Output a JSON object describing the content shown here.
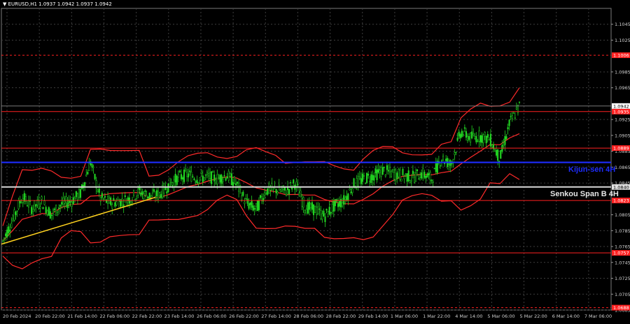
{
  "header": {
    "symbol_line": "▼ EURUSD,H1  1.0937 1.0942 1.0937 1.0942"
  },
  "chart_data": {
    "type": "candlestick",
    "symbol": "EURUSD",
    "timeframe": "H1",
    "ohlc": {
      "open": 1.0937,
      "high": 1.0942,
      "low": 1.0937,
      "close": 1.0942
    },
    "ylim": [
      1.0685,
      1.1065
    ],
    "y_ticks": [
      "1.1045",
      "1.1025",
      "1.0985",
      "1.0965",
      "1.0925",
      "1.0905",
      "1.0885",
      "1.0865",
      "1.0845",
      "1.0805",
      "1.0785",
      "1.0765",
      "1.0745",
      "1.0725",
      "1.0705",
      "1.0685"
    ],
    "x_ticks": [
      "20 Feb 2024",
      "20 Feb 22:00",
      "21 Feb 14:00",
      "22 Feb 06:00",
      "22 Feb 22:00",
      "23 Feb 14:00",
      "26 Feb 06:00",
      "26 Feb 22:00",
      "27 Feb 14:00",
      "28 Feb 06:00",
      "28 Feb 22:00",
      "29 Feb 14:00",
      "1 Mar 06:00",
      "1 Mar 22:00",
      "4 Mar 14:00",
      "5 Mar 06:00",
      "5 Mar 22:00",
      "6 Mar 14:00",
      "7 Mar 06:00"
    ],
    "current_price": "1.0942",
    "levels": [
      {
        "value": 1.1006,
        "label": "1.1006",
        "color": "#ff2020",
        "style": "dashed"
      },
      {
        "value": 1.0935,
        "label": "1.0935",
        "color": "#ff2020",
        "style": "solid"
      },
      {
        "value": 1.0889,
        "label": "1.0889",
        "color": "#ff2020",
        "style": "solid"
      },
      {
        "value": 1.0823,
        "label": "1.0823",
        "color": "#ff2020",
        "style": "solid"
      },
      {
        "value": 1.0757,
        "label": "1.0757",
        "color": "#ff2020",
        "style": "solid"
      },
      {
        "value": 1.0688,
        "label": "1.0688",
        "color": "#ff2020",
        "style": "dashed"
      }
    ],
    "kijun": {
      "value": 1.0871,
      "name": "Kijun-sen 4H",
      "color": "#1e2dff"
    },
    "senkou": {
      "value": 1.084,
      "name": "Senkou Span B 4H",
      "label": "1.0840",
      "color": "#d8d8d8"
    },
    "trendline": {
      "from": 1.0768,
      "to": 1.0827,
      "color": "#ffd21e"
    },
    "close_points": [
      1.0772,
      1.0798,
      1.0828,
      1.0813,
      1.0822,
      1.0805,
      1.0818,
      1.0822,
      1.0832,
      1.0872,
      1.0826,
      1.082,
      1.0822,
      1.0825,
      1.0834,
      1.0829,
      1.083,
      1.0842,
      1.0852,
      1.0856,
      1.0851,
      1.0853,
      1.085,
      1.0855,
      1.0843,
      1.082,
      1.0812,
      1.0836,
      1.0837,
      1.0834,
      1.0845,
      1.0815,
      1.0812,
      1.0803,
      1.0816,
      1.0823,
      1.0843,
      1.085,
      1.0854,
      1.0861,
      1.0857,
      1.0855,
      1.0852,
      1.0857,
      1.085,
      1.0877,
      1.0868,
      1.091,
      1.0902,
      1.0904,
      1.09,
      1.0875,
      1.092,
      1.0942
    ]
  }
}
